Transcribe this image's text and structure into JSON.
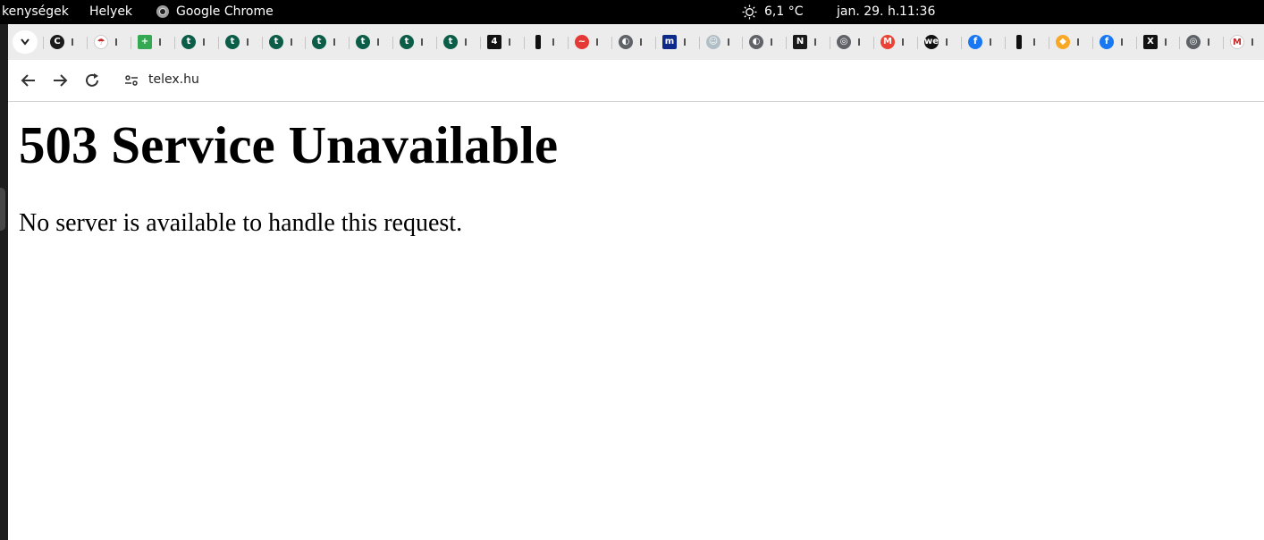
{
  "topbar": {
    "activities": "kenységek",
    "places": "Helyek",
    "app": "Google Chrome",
    "weather": "6,1 °C",
    "date": "jan. 29. h.",
    "time": "11:36"
  },
  "tabs": [
    {
      "icon": "cryptocurrency-logo-icon",
      "color": "#1a1a1a",
      "glyph": "C"
    },
    {
      "icon": "weather-app-icon",
      "color": "#ffffff",
      "glyph": "☂"
    },
    {
      "icon": "green-plus-icon",
      "color": "#34a853",
      "glyph": "+"
    },
    {
      "icon": "telex-logo-icon",
      "color": "#0b5d47",
      "glyph": "t"
    },
    {
      "icon": "telex-logo-icon",
      "color": "#0b5d47",
      "glyph": "t"
    },
    {
      "icon": "telex-logo-icon",
      "color": "#0b5d47",
      "glyph": "t"
    },
    {
      "icon": "telex-logo-icon",
      "color": "#0b5d47",
      "glyph": "t"
    },
    {
      "icon": "telex-logo-icon",
      "color": "#0b5d47",
      "glyph": "t"
    },
    {
      "icon": "telex-logo-icon",
      "color": "#0b5d47",
      "glyph": "t"
    },
    {
      "icon": "telex-logo-icon",
      "color": "#0b5d47",
      "glyph": "t"
    },
    {
      "icon": "numbered-logo-icon",
      "color": "#111111",
      "glyph": "4"
    },
    {
      "icon": "vertical-bar-icon",
      "color": "#111111",
      "glyph": "I"
    },
    {
      "icon": "red-waveform-icon",
      "color": "#e53935",
      "glyph": "~"
    },
    {
      "icon": "globe-icon",
      "color": "#5f6368",
      "glyph": "◐"
    },
    {
      "icon": "news-logo-icon",
      "color": "#0d2a8a",
      "glyph": "m"
    },
    {
      "icon": "mascot-icon",
      "color": "#b0bec5",
      "glyph": "☺"
    },
    {
      "icon": "globe-icon",
      "color": "#5f6368",
      "glyph": "◐"
    },
    {
      "icon": "yellow-logo-icon",
      "color": "#1a1a1a",
      "glyph": "N"
    },
    {
      "icon": "chrome-icon",
      "color": "#5f6368",
      "glyph": "◎"
    },
    {
      "icon": "gmail-icon",
      "color": "#ea4335",
      "glyph": "M"
    },
    {
      "icon": "we-logo-icon",
      "color": "#111111",
      "glyph": "we"
    },
    {
      "icon": "facebook-icon",
      "color": "#1877f2",
      "glyph": "f"
    },
    {
      "icon": "vertical-bar-icon",
      "color": "#111111",
      "glyph": "I"
    },
    {
      "icon": "yellow-diamond-icon",
      "color": "#f9a825",
      "glyph": "◆"
    },
    {
      "icon": "facebook-icon",
      "color": "#1877f2",
      "glyph": "f"
    },
    {
      "icon": "x-logo-icon",
      "color": "#111111",
      "glyph": "X"
    },
    {
      "icon": "chrome-icon",
      "color": "#5f6368",
      "glyph": "◎"
    },
    {
      "icon": "gmail-icon",
      "color": "#ffffff",
      "glyph": "M"
    }
  ],
  "toolbar": {
    "url": "telex.hu"
  },
  "page": {
    "heading": "503 Service Unavailable",
    "message": "No server is available to handle this request."
  }
}
